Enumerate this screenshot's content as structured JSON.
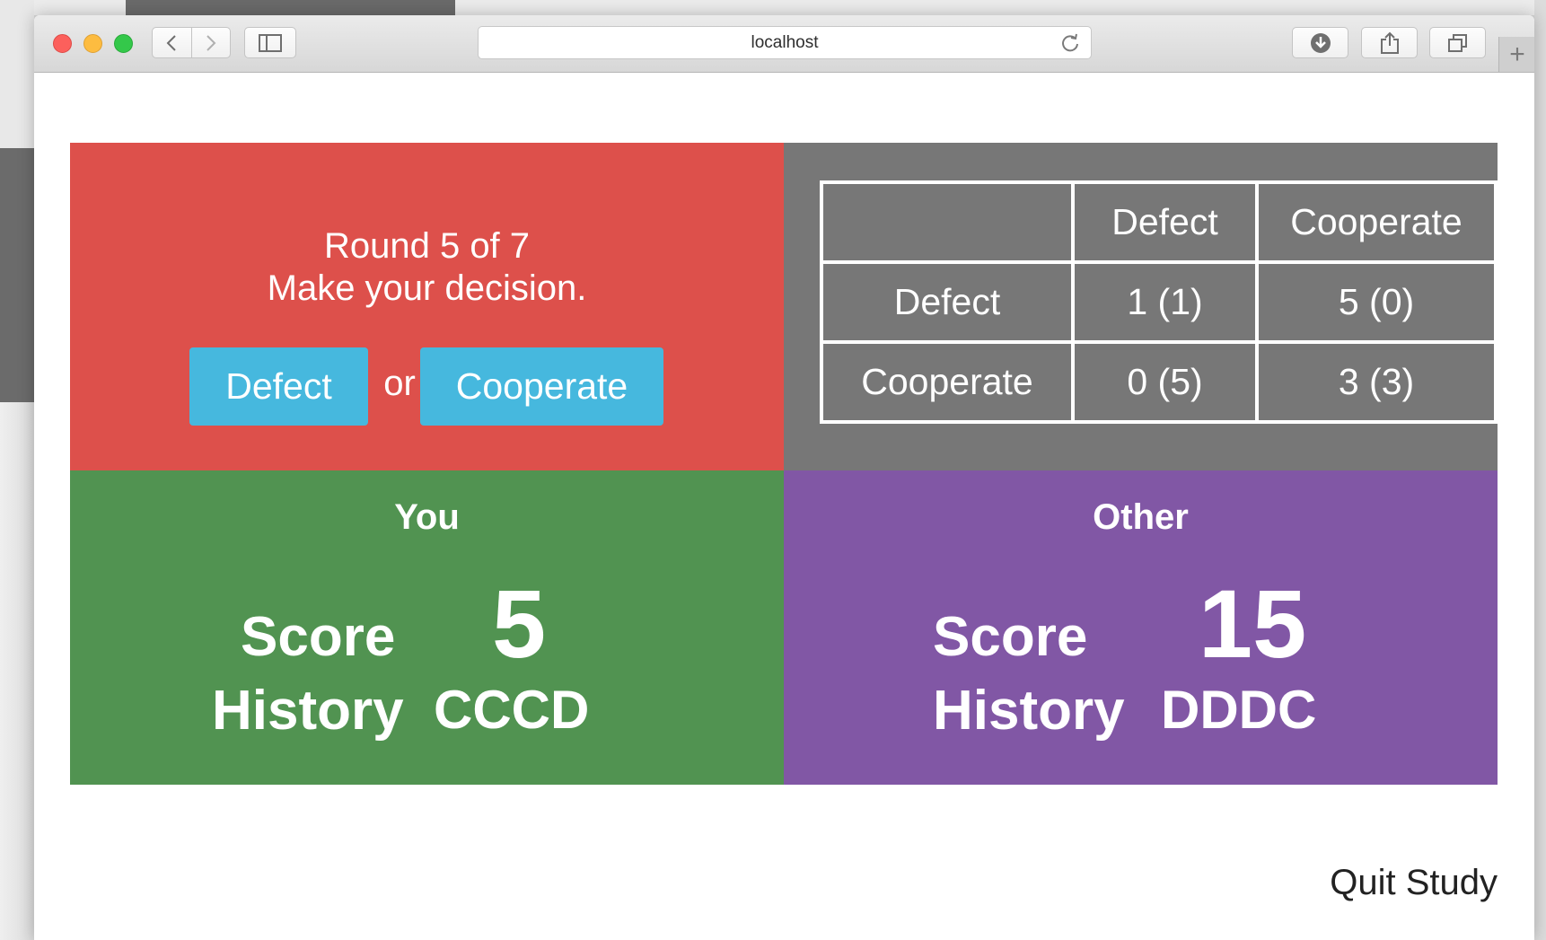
{
  "browser": {
    "url": "localhost"
  },
  "decision": {
    "round_text": "Round 5 of 7",
    "prompt": "Make your decision.",
    "defect_label": "Defect",
    "or_label": "or",
    "cooperate_label": "Cooperate"
  },
  "payoff_matrix": {
    "columns": [
      "",
      "Defect",
      "Cooperate"
    ],
    "rows": [
      [
        "Defect",
        "1 (1)",
        "5 (0)"
      ],
      [
        "Cooperate",
        "0 (5)",
        "3 (3)"
      ]
    ]
  },
  "you": {
    "title": "You",
    "score_label": "Score",
    "score": "5",
    "history_label": "History",
    "history": "CCCD"
  },
  "other": {
    "title": "Other",
    "score_label": "Score",
    "score": "15",
    "history_label": "History",
    "history": "DDDC"
  },
  "footer": {
    "quit_label": "Quit Study"
  },
  "colors": {
    "decision_panel": "#dd504b",
    "matrix_panel": "#777777",
    "you_panel": "#519351",
    "other_panel": "#8157a5",
    "button": "#46b8de"
  }
}
